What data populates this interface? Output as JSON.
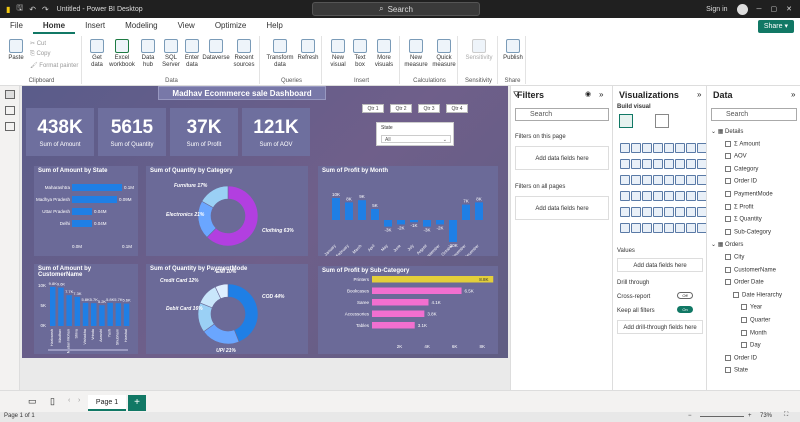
{
  "app": {
    "title": "Untitled - Power BI Desktop",
    "search_placeholder": "Search",
    "sign_in": "Sign in",
    "share": "Share"
  },
  "menu": [
    "File",
    "Home",
    "Insert",
    "Modeling",
    "View",
    "Optimize",
    "Help"
  ],
  "ribbon": {
    "clipboard": {
      "paste": "Paste",
      "cut": "Cut",
      "copy": "Copy",
      "format_painter": "Format painter",
      "label": "Clipboard"
    },
    "data": {
      "items": [
        "Get data",
        "Excel workbook",
        "Data hub",
        "SQL Server",
        "Enter data",
        "Dataverse",
        "Recent sources"
      ],
      "label": "Data"
    },
    "queries": {
      "items": [
        "Transform data",
        "Refresh"
      ],
      "label": "Queries"
    },
    "insert": {
      "items": [
        "New visual",
        "Text box",
        "More visuals"
      ],
      "label": "Insert"
    },
    "calculations": {
      "items": [
        "New measure",
        "Quick measure"
      ],
      "label": "Calculations"
    },
    "sensitivity": {
      "items": [
        "Sensitivity"
      ],
      "label": "Sensitivity"
    },
    "share": {
      "items": [
        "Publish"
      ],
      "label": "Share"
    }
  },
  "report": {
    "title": "Madhav Ecommerce sale Dashboard",
    "slicers": [
      "Qtr 1",
      "Qtr 2",
      "Qtr 3",
      "Qtr 4"
    ],
    "state_slicer": {
      "label": "State",
      "value": "All"
    },
    "cards": [
      {
        "value": "438K",
        "caption": "Sum of Amount"
      },
      {
        "value": "5615",
        "caption": "Sum of Quantity"
      },
      {
        "value": "37K",
        "caption": "Sum of Profit"
      },
      {
        "value": "121K",
        "caption": "Sum of AOV"
      }
    ],
    "visuals": {
      "amount_by_state": {
        "title": "Sum of Amount by State"
      },
      "qty_by_category": {
        "title": "Sum of Quantity by Category"
      },
      "profit_by_month": {
        "title": "Sum of Profit by Month"
      },
      "amount_by_customer": {
        "title": "Sum of Amount by CustomerName"
      },
      "qty_by_payment": {
        "title": "Sum of Quantity by PaymentMode"
      },
      "profit_by_subcat": {
        "title": "Sum of Profit by Sub-Category"
      }
    }
  },
  "chart_data": [
    {
      "type": "bar",
      "title": "Sum of Amount by State",
      "categories": [
        "Maharashtra",
        "Madhya Pradesh",
        "Uttar Pradesh",
        "Delhi"
      ],
      "values": [
        0.1,
        0.09,
        0.04,
        0.04
      ],
      "data_labels": [
        "0.1M",
        "0.09M",
        "0.04M",
        "0.04M"
      ],
      "x_ticks": [
        "0.0M",
        "0.1M"
      ],
      "colors": {
        "bar": "#1f7fe5"
      }
    },
    {
      "type": "pie",
      "title": "Sum of Quantity by Category",
      "categories": [
        "Clothing",
        "Electronics",
        "Furniture"
      ],
      "values": [
        63,
        21,
        17
      ],
      "data_labels": [
        "Clothing 63%",
        "Electronics 21%",
        "Furniture 17%"
      ],
      "colors": {
        "Clothing": "#b23fe0",
        "Electronics": "#6aa6ff",
        "Furniture": "#9ad0f5"
      }
    },
    {
      "type": "bar",
      "title": "Sum of Profit by Month",
      "categories": [
        "January",
        "February",
        "March",
        "April",
        "May",
        "June",
        "July",
        "August",
        "September",
        "October",
        "November",
        "December"
      ],
      "values": [
        10,
        8,
        9,
        5,
        -3,
        -2,
        -1,
        -3,
        -2,
        -10,
        7,
        8
      ],
      "data_labels": [
        "10K",
        "8K",
        "9K",
        "5K",
        "-3K",
        "-2K",
        "-1K",
        "-3K",
        "-2K",
        "-10K",
        "7K",
        "8K"
      ],
      "colors": {
        "positive": "#1f7fe5",
        "negative": "#1f7fe5"
      }
    },
    {
      "type": "bar",
      "title": "Sum of Amount by CustomerName",
      "categories": [
        "Harivansh",
        "Madhav",
        "Madan Mohan",
        "Shiva",
        "Vishakha",
        "Vrinda",
        "Aarushi",
        "Yash",
        "Shubham",
        "Harshal"
      ],
      "values": [
        9.8,
        9.6,
        7.7,
        7.3,
        5.8,
        5.7,
        5.2,
        5.8,
        5.7,
        5.6
      ],
      "data_labels": [
        "9.8K",
        "9.6K",
        "7.7K",
        "7.3K",
        "5.8K",
        "5.7K",
        "5.2K",
        "5.8K",
        "5.7K",
        "5.6K"
      ],
      "y_ticks": [
        "0K",
        "5K",
        "10K"
      ],
      "colors": {
        "bar": "#1f7fe5"
      }
    },
    {
      "type": "pie",
      "title": "Sum of Quantity by PaymentMode",
      "categories": [
        "COD",
        "UPI",
        "Debit Card",
        "Credit Card",
        "EMI"
      ],
      "values": [
        44,
        21,
        16,
        12,
        7
      ],
      "data_labels": [
        "COD 44%",
        "UPI 21%",
        "Debit Card 16%",
        "Credit Card 12%",
        "EMI 10%"
      ],
      "colors": {
        "COD": "#1f7fe5",
        "UPI": "#6aa6ff",
        "Debit Card": "#9ad0f5",
        "Credit Card": "#c9e6fb",
        "EMI": "#dfefff"
      }
    },
    {
      "type": "bar",
      "title": "Sum of Profit by Sub-Category",
      "categories": [
        "Printers",
        "Bookcases",
        "Saree",
        "Accessories",
        "Tables"
      ],
      "values": [
        8.8,
        6.5,
        4.1,
        3.8,
        3.1
      ],
      "data_labels": [
        "8.8K",
        "6.5K",
        "4.1K",
        "3.8K",
        "3.1K"
      ],
      "x_ticks": [
        "2K",
        "4K",
        "6K",
        "8K"
      ],
      "colors": {
        "bar": "#f26fd0",
        "top": "#e3cf3a"
      }
    }
  ],
  "pages": {
    "tab": "Page 1",
    "add": "+"
  },
  "status": {
    "left": "Page 1 of 1",
    "zoom": "73%"
  },
  "filters": {
    "title": "Filters",
    "search": "Search",
    "on_page": "Filters on this page",
    "on_all": "Filters on all pages",
    "add": "Add data fields here"
  },
  "visualizations": {
    "title": "Visualizations",
    "build": "Build visual",
    "values": "Values",
    "add": "Add data fields here",
    "drill": "Drill through",
    "cross": "Cross-report",
    "keep": "Keep all filters",
    "cross_state": "Off",
    "keep_state": "On",
    "add_drill": "Add drill-through fields here"
  },
  "data": {
    "title": "Data",
    "search": "Search",
    "tables": [
      {
        "name": "Details",
        "fields": [
          "Amount",
          "AOV",
          "Category",
          "Order ID",
          "PaymentMode",
          "Profit",
          "Quantity",
          "Sub-Category"
        ]
      },
      {
        "name": "Orders",
        "fields": [
          "City",
          "CustomerName",
          "Order Date",
          "Date Hierarchy",
          "Year",
          "Quarter",
          "Month",
          "Day",
          "Order ID",
          "State"
        ]
      }
    ]
  }
}
